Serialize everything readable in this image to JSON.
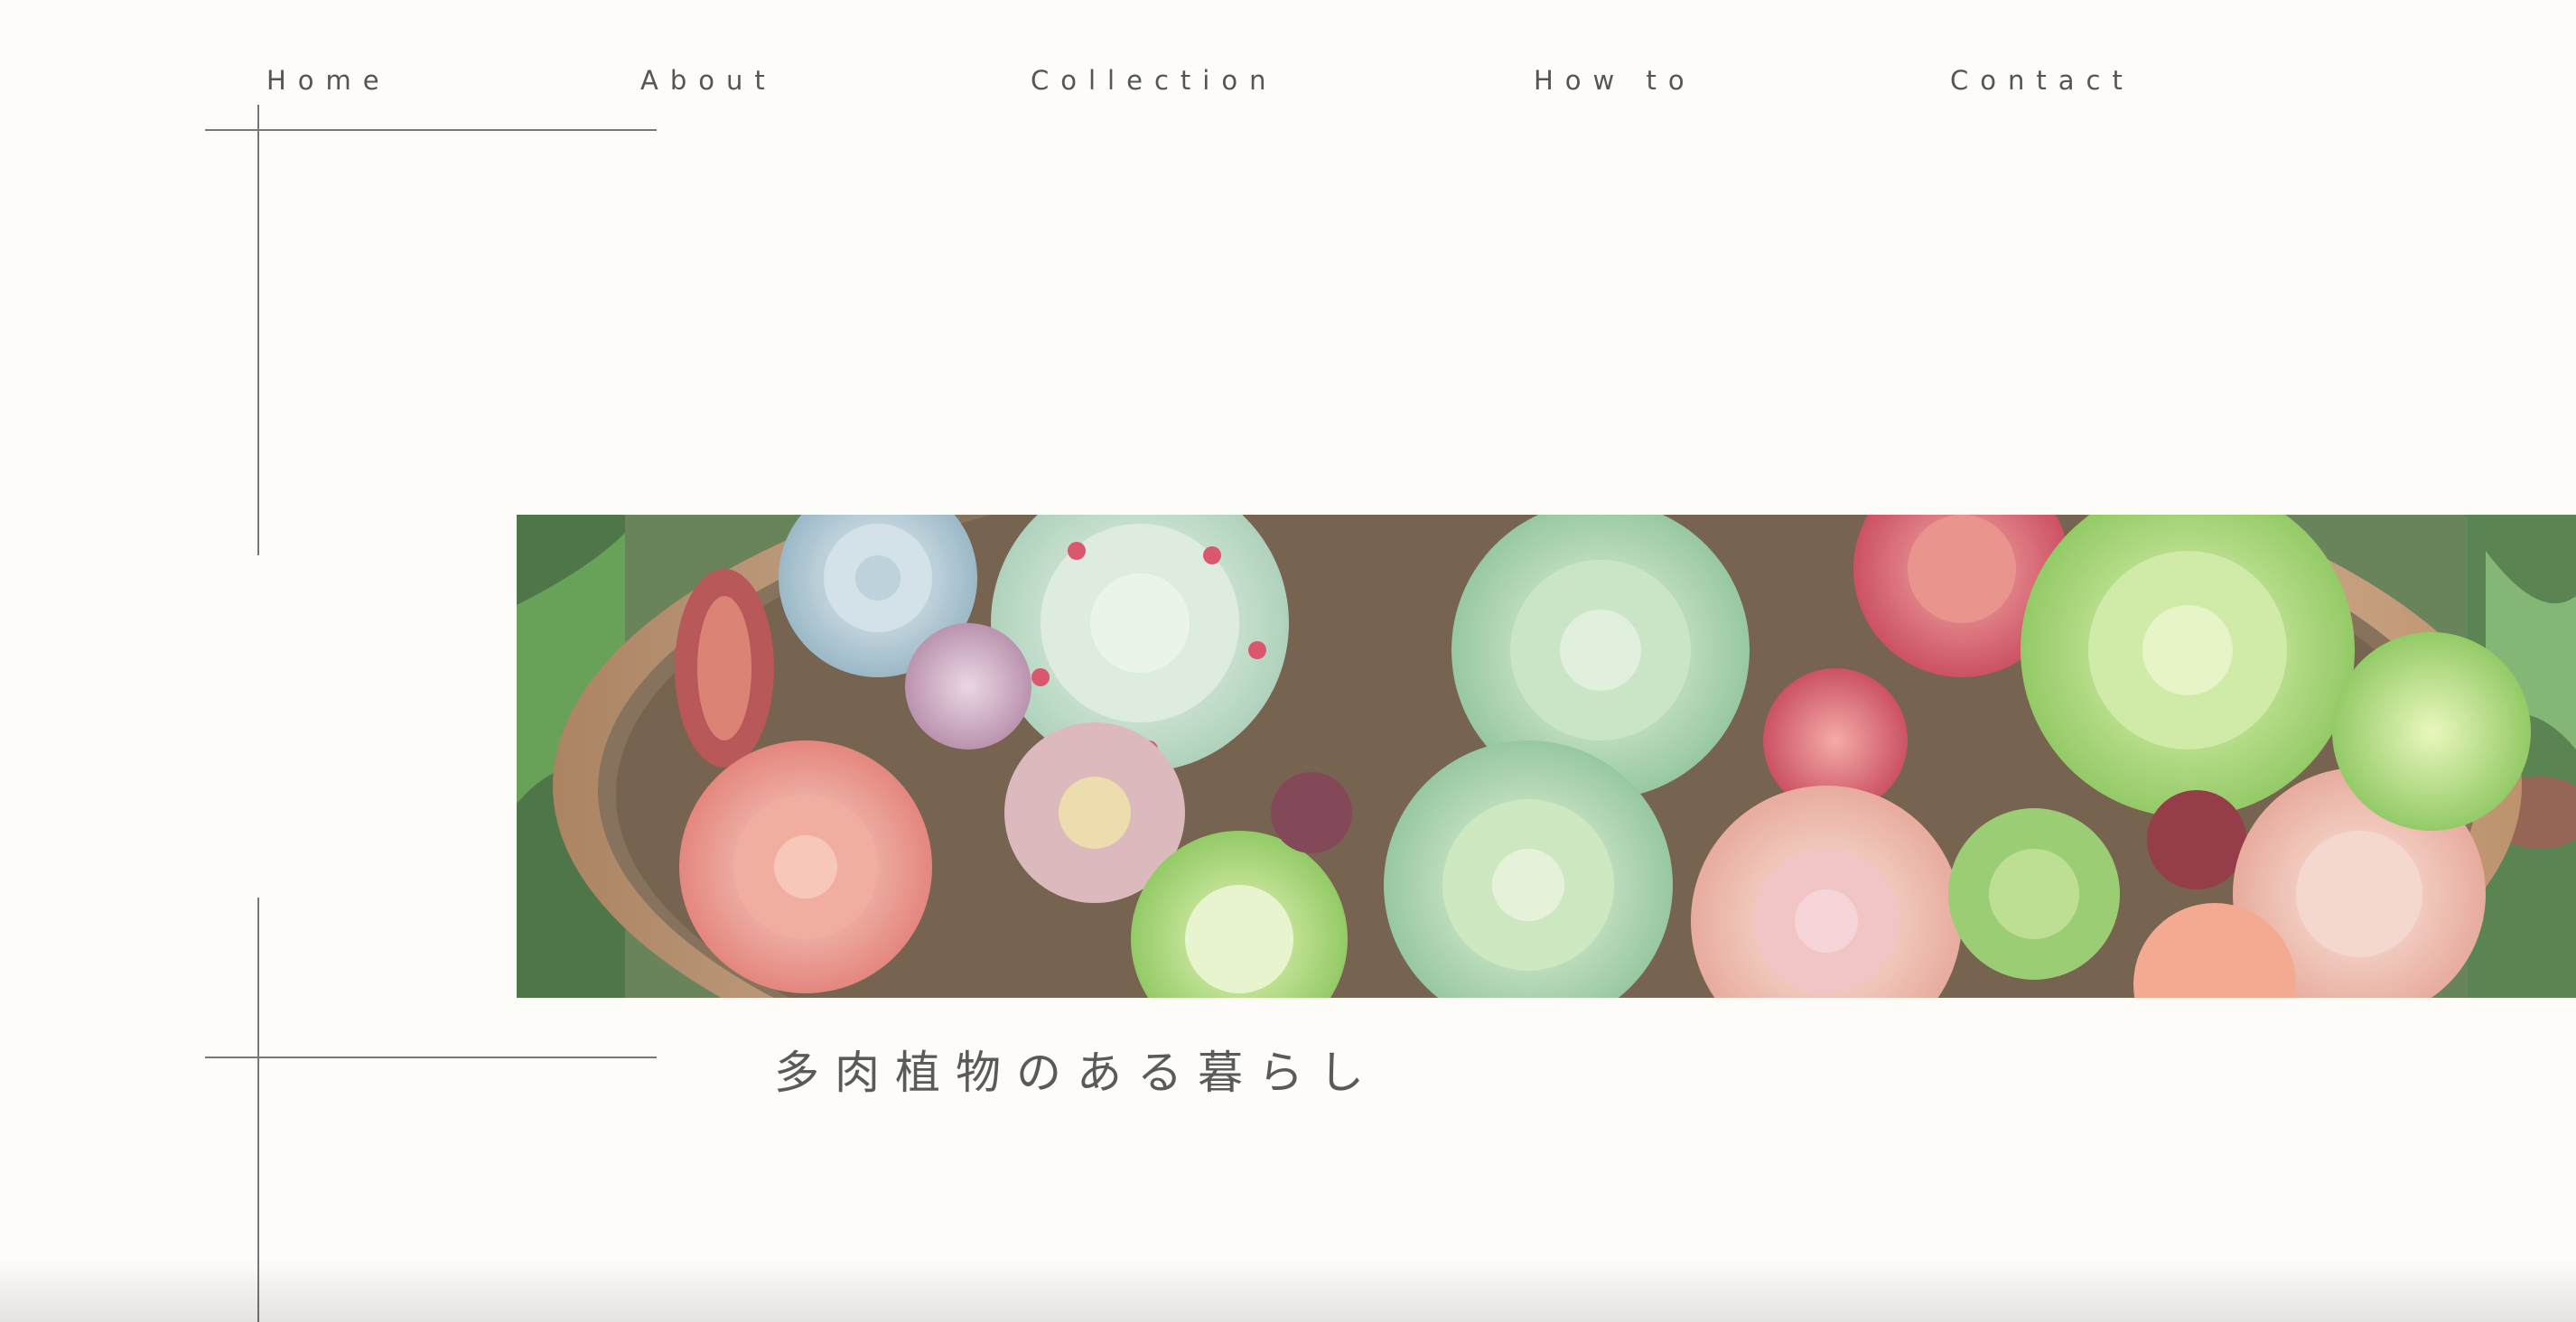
{
  "nav": {
    "items": [
      {
        "label": "Home"
      },
      {
        "label": "About"
      },
      {
        "label": "Collection"
      },
      {
        "label": "How to"
      },
      {
        "label": "Contact"
      }
    ]
  },
  "hero": {
    "image_icon": "succulent-arrangement-photo"
  },
  "tagline": "多肉植物のある暮らし",
  "colors": {
    "background": "#fdfcf8",
    "text": "#555555",
    "line": "#777777"
  }
}
